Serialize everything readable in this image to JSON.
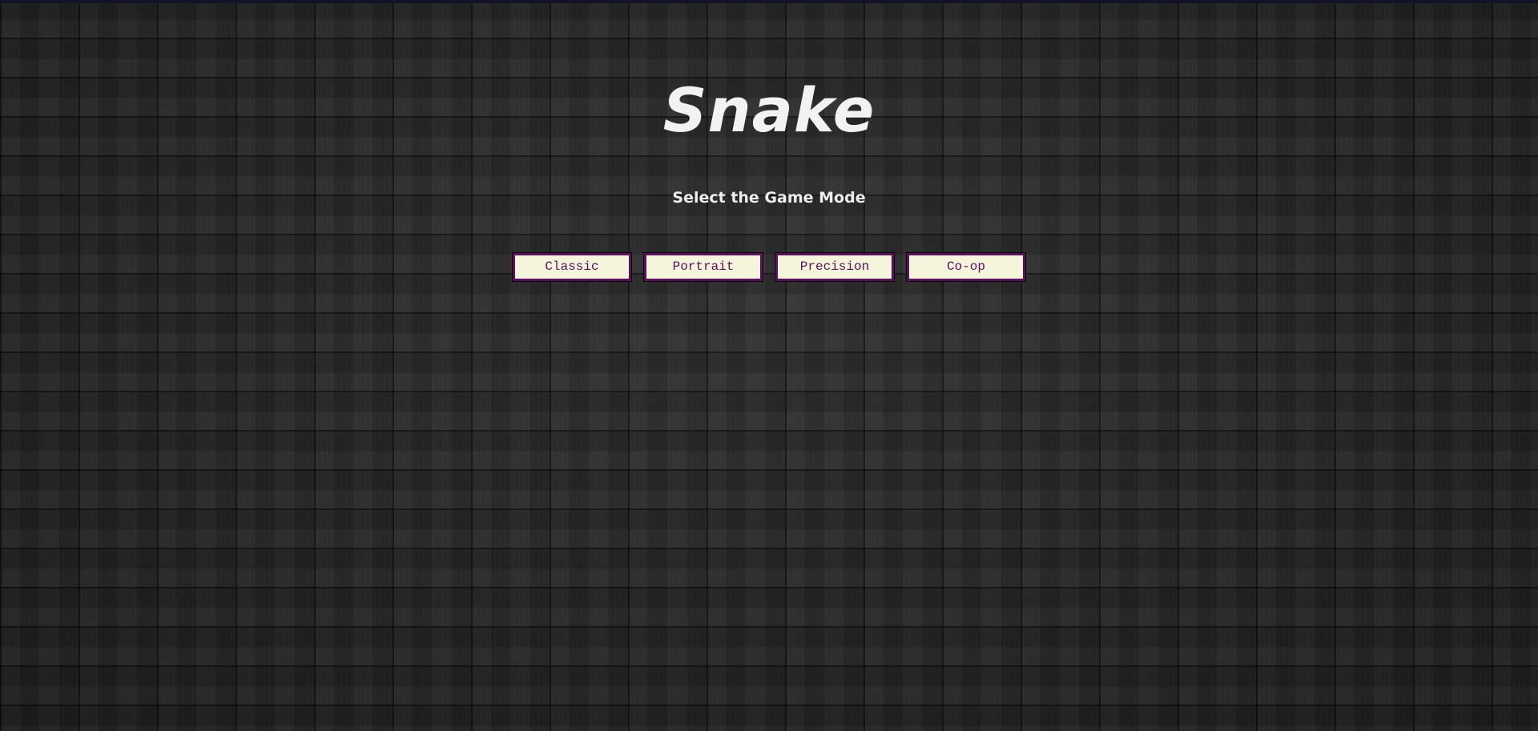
{
  "game": {
    "title": "Snake",
    "subtitle": "Select the Game Mode"
  },
  "modes": [
    {
      "label": "Classic"
    },
    {
      "label": "Portrait"
    },
    {
      "label": "Precision"
    },
    {
      "label": "Co-op"
    }
  ],
  "colors": {
    "background": "#272727",
    "title": "#f2f2f2",
    "button_fill": "#f5f5dc",
    "button_border": "#5c0f5c",
    "button_text": "#5c0f5c"
  }
}
